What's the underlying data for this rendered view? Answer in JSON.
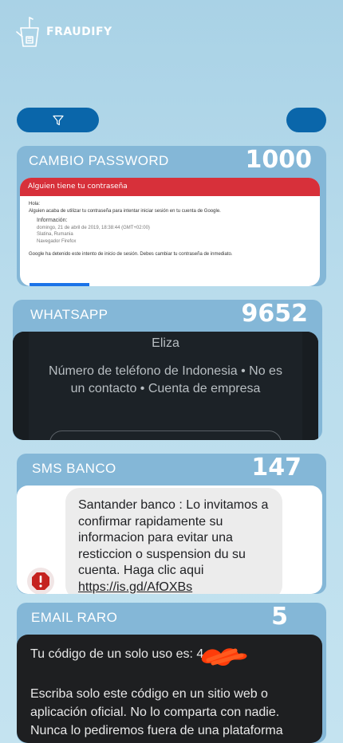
{
  "app": {
    "name": "FRAUDIFY"
  },
  "toolbar": {
    "filter_icon": "filter-icon"
  },
  "cards": [
    {
      "title": "CAMBIO PASSWORD",
      "count": "1000",
      "shot": {
        "header": "Alguien tiene tu contraseña",
        "greeting": "Hola:",
        "line": "Alguien acaba de utilizar tu contraseña para intentar iniciar sesión en tu cuenta de Google.",
        "info_title": "Información:",
        "info_date": "domingo, 21 de abril de 2019, 18:38:44 (GMT+02:00)",
        "info_place": "Slatina, Rumania",
        "info_browser": "Navegador Firefox",
        "footer": "Google ha detenido este intento de inicio de sesión. Debes cambiar tu contraseña de inmediato."
      }
    },
    {
      "title": "WHATSAPP",
      "count": "9652",
      "shot": {
        "name": "Eliza",
        "info": "Número de teléfono de Indonesia  •  No es un contacto  •  Cuenta de empresa"
      }
    },
    {
      "title": "SMS BANCO",
      "count": "147",
      "shot": {
        "message": "Santander banco : Lo invitamos a confirmar rapidamente su informacion para evitar una resticcion o suspension du su cuenta. Haga clic aqui ",
        "link": "https://is.gd/AfOXBs"
      }
    },
    {
      "title": "EMAIL RARO",
      "count": "5",
      "shot": {
        "line1": "Tu código de un solo uso es: 4",
        "line2": "Escriba solo este código en un sitio web o aplicación oficial. No lo comparta con nadie. Nunca lo pediremos fuera de una plataforma"
      }
    }
  ],
  "colors": {
    "background": "#b9dcec",
    "card": "#84b7d7",
    "button": "#0a66aa",
    "mail_header": "#d7303a",
    "redaction": "#ff3c0a"
  }
}
